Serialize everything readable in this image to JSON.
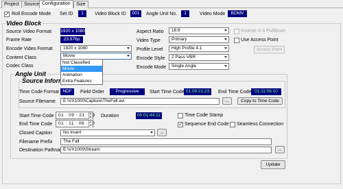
{
  "tabs": [
    {
      "label": "Project"
    },
    {
      "label": "Source"
    },
    {
      "label": "Configuration"
    },
    {
      "label": "Size"
    }
  ],
  "header": {
    "roll_encode_mode_label": "Roll Encode Mode",
    "roll_encode_mode_checked": true,
    "set_id_label": "Set ID",
    "set_id_value": "1",
    "video_block_id_label": "Video Block ID",
    "video_block_id_value": "001",
    "angle_unit_no_label": "Angle Unit No.",
    "angle_unit_no_value": "1",
    "video_mode_label": "Video Mode",
    "video_mode_value": "BDMV"
  },
  "video_block": {
    "title": "Video Block",
    "source_video_format_label": "Source Video Format",
    "source_video_format_value": "1920 x 1080",
    "frame_rate_label": "Frame Rate",
    "frame_rate_value": "23.976p",
    "encode_video_format_label": "Encode Video Format",
    "encode_video_format_value": "1920 x 1080",
    "content_class_label": "Content Class",
    "content_class_value": "Movie",
    "codec_class_label": "Codec Class",
    "content_class_options": [
      "Not Classified",
      "Movie",
      "Animation",
      "Extra Features"
    ],
    "content_class_selected_index": 1,
    "aspect_ratio_label": "Aspect Ratio",
    "aspect_ratio_value": "16:9",
    "video_type_label": "Video Type",
    "video_type_value": "Primary",
    "profile_level_label": "Profile Level",
    "profile_level_value": "High Profile 4.1",
    "encode_style_label": "Encode Style",
    "encode_style_value": "2 Pass VBR",
    "encode_mode_label": "Encode Mode",
    "encode_mode_value": "Single Angle",
    "inverse_pulldown_label": "Inverse 2-3 Pulldown",
    "use_access_point_label": "Use Access Point",
    "access_point_button": "Access Point"
  },
  "angle_unit": {
    "title": "Angle Unit",
    "source_information_title": "Source Information",
    "time_code_format_label": "Time Code Format",
    "time_code_format_value": "NDF",
    "field_order_label": "Field Order",
    "field_order_value": "Progressive",
    "start_time_code_label": "Start Time Code",
    "start_time_code_value": "01:09:21:23",
    "end_time_code_label": "End Time Code",
    "end_time_code_value": "01:11:06:10",
    "source_filename_label": "Source Filename",
    "source_filename_value": "E:\\VX1000\\Capture\\TheFall.avi",
    "browse_button": "...",
    "copy_time_code_button": "Copy to Time Code",
    "start_tc_label": "Start Time Code",
    "start_tc_parts": [
      "01",
      "09",
      "21",
      "23"
    ],
    "end_tc_label": "End Time Code",
    "end_tc_parts": [
      "01",
      "11",
      "06",
      "10"
    ],
    "duration_label": "Duration",
    "duration_value": "00:01:44:11",
    "time_code_stamp_label": "Time Code Stamp",
    "sequence_end_code_label": "Sequence End Code",
    "seamless_connection_label": "Seamless Connection",
    "closed_caption_label": "Closed Caption",
    "closed_caption_value": "No Insert",
    "filename_prefix_label": "Filename Prefix",
    "filename_prefix_value": "The Fall",
    "destination_pathname_label": "Destination Pathname",
    "destination_pathname_value": "E:\\VX1000\\Stream",
    "update_button": "Update"
  },
  "colors": {
    "field_navy": "#000080",
    "highlight": "#3399ff"
  }
}
